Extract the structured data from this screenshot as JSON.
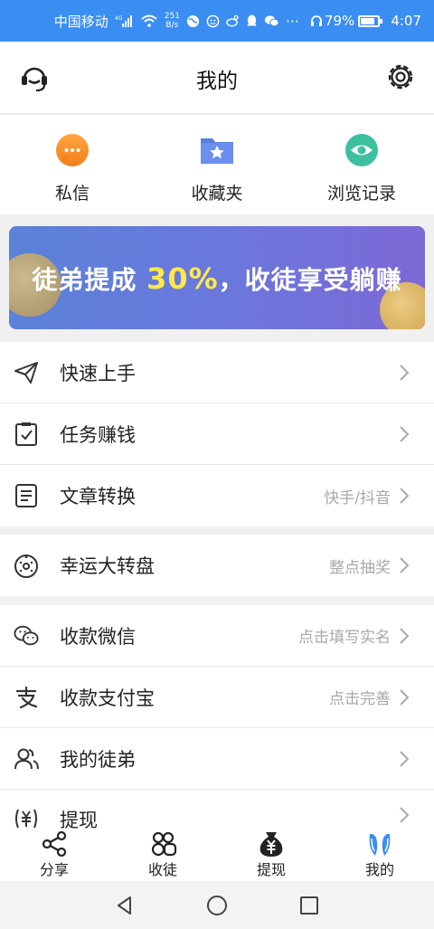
{
  "status_bar": {
    "carrier": "中国移动",
    "network": "4G",
    "speed_value": "251",
    "speed_unit": "B/s",
    "battery": "79%",
    "time": "4:07"
  },
  "header": {
    "title": "我的",
    "left_icon": "customer-service-icon",
    "right_icon": "gear-icon"
  },
  "quick_entries": [
    {
      "label": "私信",
      "icon": "message-bubble-icon",
      "color": "#f59a23"
    },
    {
      "label": "收藏夹",
      "icon": "star-folder-icon",
      "color": "#5a7fe0"
    },
    {
      "label": "浏览记录",
      "icon": "eye-icon",
      "color": "#3cc0a0"
    }
  ],
  "banner": {
    "text_before": "徒弟提成 ",
    "highlight": "30%",
    "text_after": "，收徒享受躺赚"
  },
  "menu_groups": [
    [
      {
        "label": "快速上手",
        "sub": "",
        "icon": "paper-plane-icon"
      },
      {
        "label": "任务赚钱",
        "sub": "",
        "icon": "clipboard-check-icon"
      },
      {
        "label": "文章转换",
        "sub": "快手/抖音",
        "icon": "document-icon"
      }
    ],
    [
      {
        "label": "幸运大转盘",
        "sub": "整点抽奖",
        "icon": "wheel-icon"
      }
    ],
    [
      {
        "label": "收款微信",
        "sub": "点击填写实名",
        "icon": "wechat-icon"
      },
      {
        "label": "收款支付宝",
        "sub": "点击完善",
        "icon": "alipay-icon"
      },
      {
        "label": "我的徒弟",
        "sub": "",
        "icon": "users-icon"
      },
      {
        "label": "提现",
        "sub": "",
        "icon": "yuan-icon"
      }
    ]
  ],
  "tabs": [
    {
      "label": "分享",
      "icon": "share-icon",
      "active": false
    },
    {
      "label": "收徒",
      "icon": "recruit-icon",
      "active": false
    },
    {
      "label": "提现",
      "icon": "money-bag-icon",
      "active": false
    },
    {
      "label": "我的",
      "icon": "bunny-ears-icon",
      "active": true
    }
  ],
  "colors": {
    "status_bar": "#3a8ef2",
    "active_tab": "#3a8ef2",
    "sub_text": "#a8a8a8",
    "banner_highlight": "#ffe84a"
  }
}
